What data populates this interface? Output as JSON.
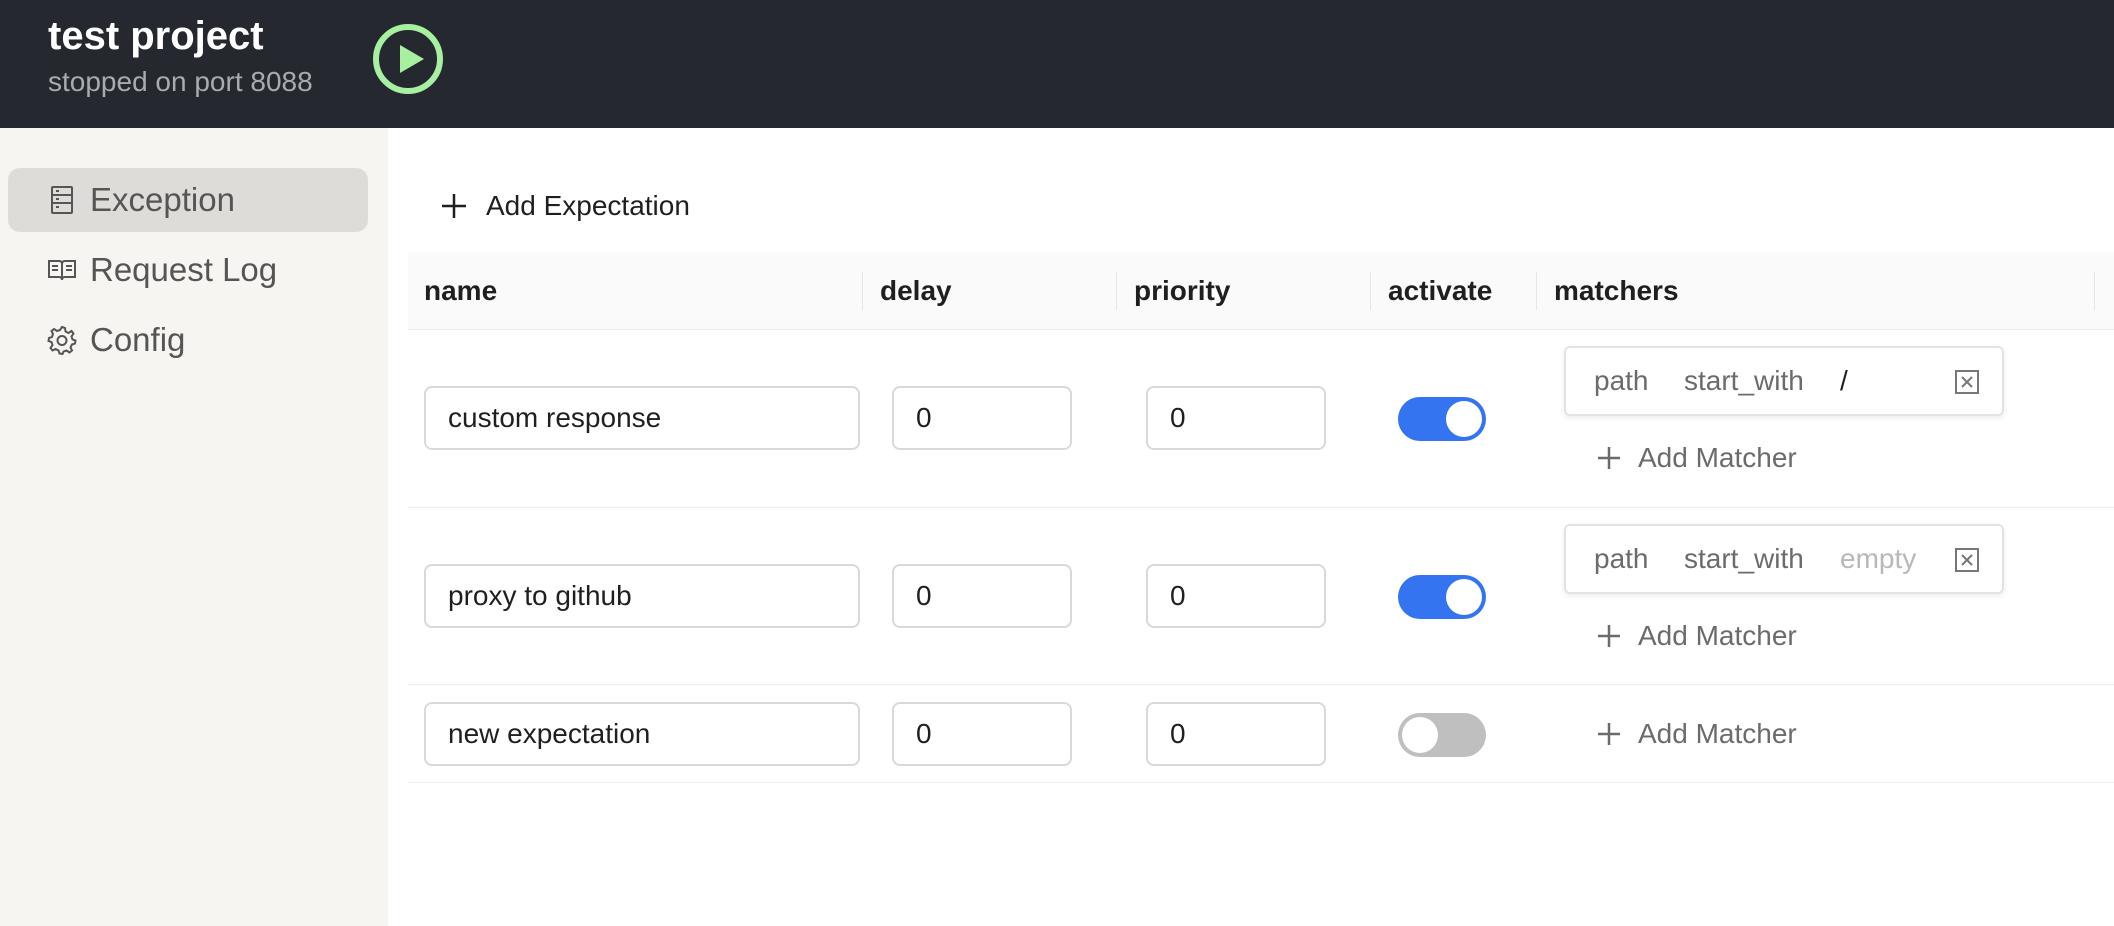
{
  "header": {
    "title": "test project",
    "status": "stopped on port 8088",
    "play_icon": "play-circle-icon",
    "accent": "#a6f0a0"
  },
  "sidebar": {
    "items": [
      {
        "label": "Exception",
        "icon": "list-icon",
        "active": true
      },
      {
        "label": "Request Log",
        "icon": "book-icon",
        "active": false
      },
      {
        "label": "Config",
        "icon": "gear-icon",
        "active": false
      }
    ]
  },
  "main": {
    "add_expectation_label": "Add Expectation",
    "columns": [
      "name",
      "delay",
      "priority",
      "activate",
      "matchers"
    ],
    "rows": [
      {
        "name": "custom response",
        "delay": "0",
        "priority": "0",
        "active": true,
        "matchers": [
          {
            "field": "path",
            "op": "start_with",
            "value": "/",
            "placeholder": "empty"
          }
        ],
        "add_matcher_label": "Add Matcher"
      },
      {
        "name": "proxy to github",
        "delay": "0",
        "priority": "0",
        "active": true,
        "matchers": [
          {
            "field": "path",
            "op": "start_with",
            "value": "",
            "placeholder": "empty"
          }
        ],
        "add_matcher_label": "Add Matcher"
      },
      {
        "name": "new expectation",
        "delay": "0",
        "priority": "0",
        "active": false,
        "matchers": [],
        "add_matcher_label": "Add Matcher"
      }
    ]
  },
  "colors": {
    "topbar": "#25282e",
    "toggle_on": "#3574f0",
    "toggle_off": "#bfbfbf",
    "sidebar_bg": "#f6f5f2",
    "sidebar_active": "#dddcd8"
  }
}
